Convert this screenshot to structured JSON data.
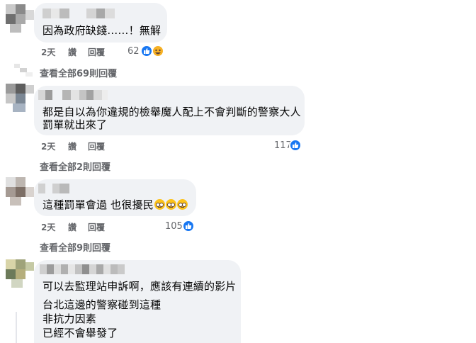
{
  "comments": [
    {
      "lines": [
        "因為政府缺錢……！無解"
      ],
      "time": "2天",
      "like_label": "讚",
      "reply_label": "回覆",
      "reaction_count": "62",
      "view_replies": "查看全部69則回覆"
    },
    {
      "lines": [
        "都是自以為你違規的檢舉魔人配上不會判斷的警察大人",
        "罰單就出來了"
      ],
      "time": "2天",
      "like_label": "讚",
      "reply_label": "回覆",
      "reaction_count": "117",
      "view_replies": "查看全部2則回覆"
    },
    {
      "lines": [
        "這種罰單會過 也很擾民"
      ],
      "time": "2天",
      "like_label": "讚",
      "reply_label": "回覆",
      "reaction_count": "105",
      "view_replies": "查看全部9則回覆"
    },
    {
      "lines": [
        "可以去監理站申訴啊，應該有連續的影片"
      ],
      "lines2": [
        "台北這邊的警察碰到這種",
        "非抗力因素",
        "已經不會舉發了"
      ]
    }
  ],
  "colors": {
    "bubble": "#f0f2f5",
    "meta_text": "#65676b",
    "like_blue": "#1877f2",
    "haha_yellow": "#f7b125"
  },
  "icons": [
    "like-reaction-icon",
    "haha-reaction-icon",
    "rolling-eyes-emoji-icon"
  ]
}
